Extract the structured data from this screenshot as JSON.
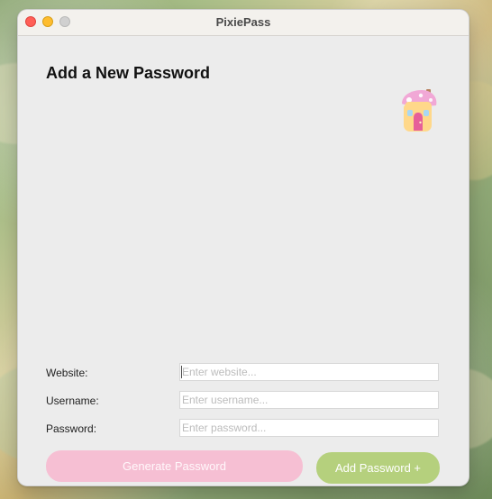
{
  "window": {
    "title": "PixiePass"
  },
  "page": {
    "heading": "Add a New Password"
  },
  "form": {
    "website_label": "Website:",
    "website_placeholder": "Enter website...",
    "username_label": "Username:",
    "username_placeholder": "Enter username...",
    "password_label": "Password:",
    "password_placeholder": "Enter password..."
  },
  "buttons": {
    "generate": "Generate Password",
    "add": "Add Password +"
  },
  "icons": {
    "close": "close-icon",
    "minimize": "minimize-icon",
    "zoom": "zoom-icon",
    "logo": "mushroom-house-icon"
  },
  "colors": {
    "window_bg": "#ececec",
    "titlebar_bg": "#f3f1ed",
    "generate_button": "#f6bfd3",
    "add_button": "#b5d07d",
    "close": "#ff5f57",
    "minimize": "#febc2e",
    "zoom": "#d0d0d0"
  }
}
